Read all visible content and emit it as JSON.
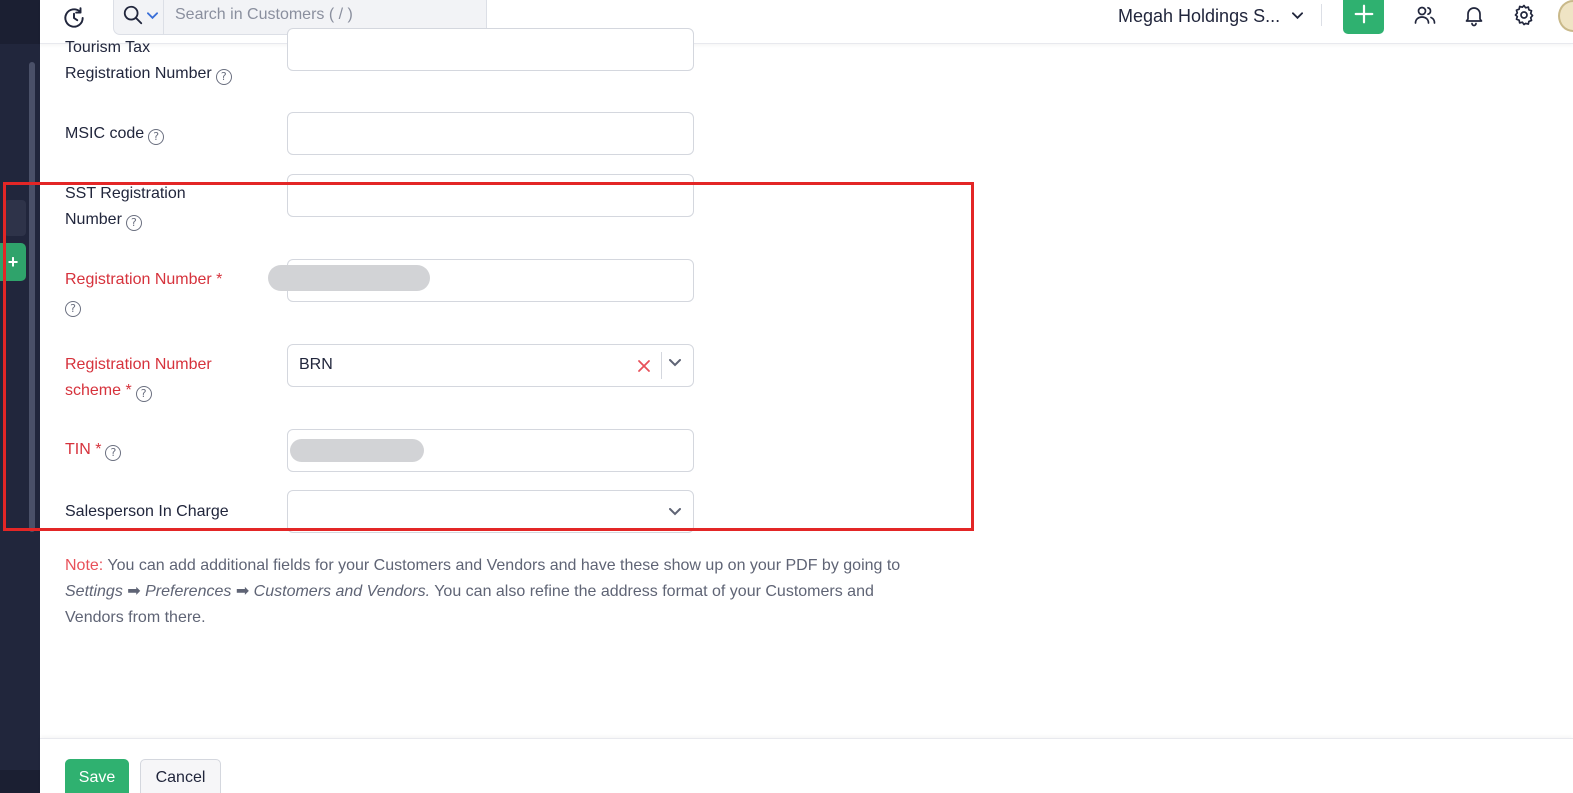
{
  "header": {
    "search_placeholder": "Search in Customers ( / )",
    "organization": "Megah Holdings S..."
  },
  "form": {
    "tourism_tax": {
      "label_line1": "Tourism Tax",
      "label_line2": "Registration Number",
      "value": ""
    },
    "msic": {
      "label": "MSIC code",
      "value": ""
    },
    "sst": {
      "label_line1": "SST Registration",
      "label_line2": "Number",
      "value": ""
    },
    "registration_number": {
      "label": "Registration Number *",
      "value": ""
    },
    "registration_scheme": {
      "label_line1": "Registration Number",
      "label_line2": "scheme *",
      "value": "BRN"
    },
    "tin": {
      "label": "TIN *",
      "value": ""
    },
    "salesperson": {
      "label": "Salesperson In Charge",
      "value": ""
    }
  },
  "note": {
    "label": "Note:",
    "text1": " You can add additional fields for your Customers and Vendors and have these show up on your PDF by going to ",
    "settings": "Settings",
    "arrow1": " ➡ ",
    "preferences": "Preferences",
    "arrow2": " ➡ ",
    "customers_vendors": "Customers and Vendors.",
    "text2": " You can also refine the address format of your Customers and Vendors from there."
  },
  "footer": {
    "save_label": "Save",
    "cancel_label": "Cancel"
  },
  "colors": {
    "accent_green": "#2fb170",
    "required_red": "#d6323c",
    "highlight_red": "#e32626",
    "sidebar_dark": "#21263c"
  },
  "icons": [
    "recent-history-icon",
    "search-icon",
    "chevron-down-icon",
    "plus-icon",
    "users-icon",
    "bell-icon",
    "gear-icon",
    "help-icon",
    "clear-x-icon"
  ]
}
